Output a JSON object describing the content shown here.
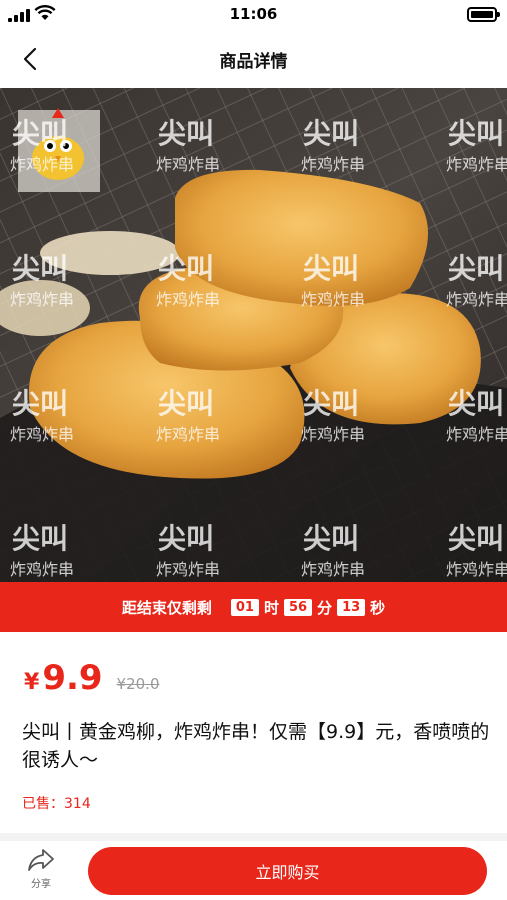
{
  "status_bar": {
    "time": "11:06"
  },
  "nav": {
    "title": "商品详情",
    "back_icon": "chevron-left-icon"
  },
  "product_image": {
    "watermark_brand": "尖叫",
    "watermark_sub": "炸鸡炸串"
  },
  "countdown": {
    "label": "距结束仅剩剩",
    "hours": "01",
    "hours_unit": "时",
    "minutes": "56",
    "minutes_unit": "分",
    "seconds": "13",
    "seconds_unit": "秒"
  },
  "price": {
    "symbol": "¥",
    "current": "9.9",
    "original": "¥20.0"
  },
  "product": {
    "title": "尖叫丨黄金鸡柳，炸鸡炸串！仅需【9.9】元，香喷喷的很诱人～",
    "sold_label": "已售：",
    "sold_count": "314"
  },
  "bottom_bar": {
    "share_label": "分享",
    "share_icon": "share-icon",
    "buy_label": "立即购买"
  },
  "colors": {
    "accent": "#e8261a"
  }
}
